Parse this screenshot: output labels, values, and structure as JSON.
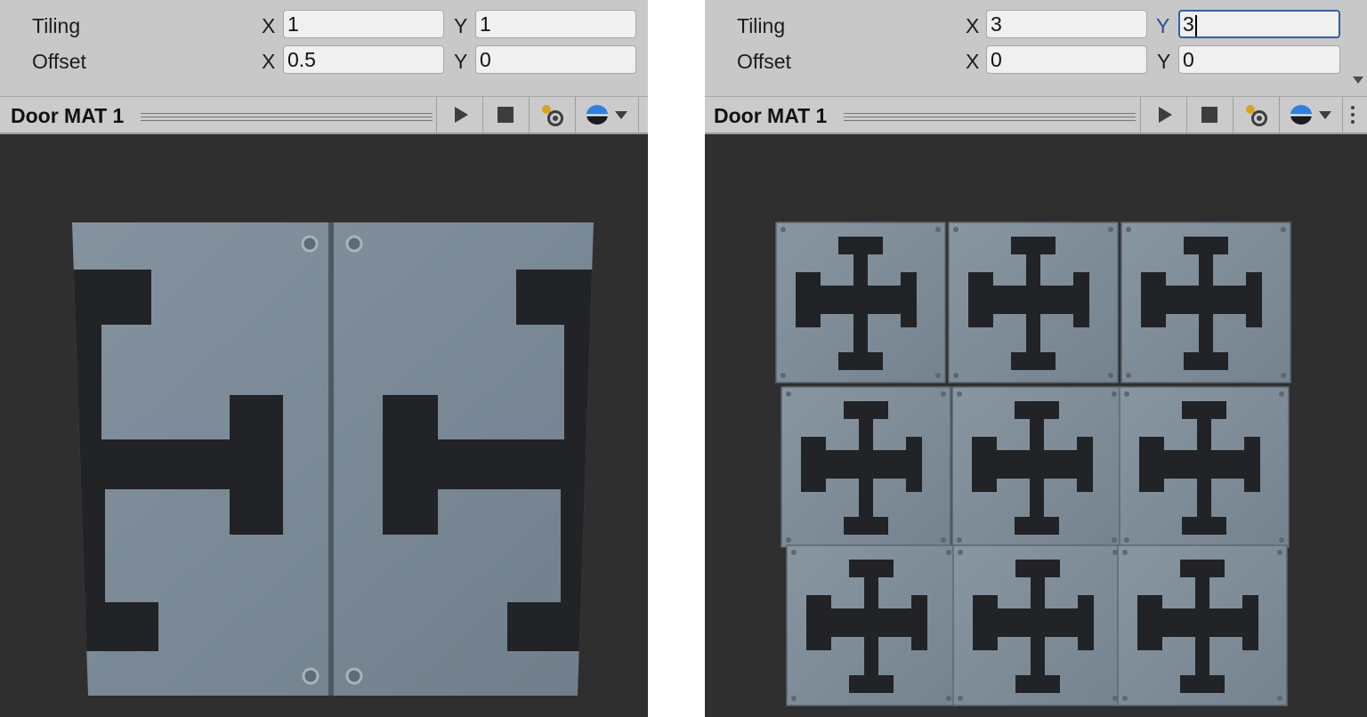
{
  "left": {
    "inspector": {
      "tiling_label": "Tiling",
      "offset_label": "Offset",
      "x_label": "X",
      "y_label": "Y",
      "tiling_x": "1",
      "tiling_y": "1",
      "offset_x": "0.5",
      "offset_y": "0"
    },
    "preview": {
      "title": "Door MAT 1"
    }
  },
  "right": {
    "inspector": {
      "tiling_label": "Tiling",
      "offset_label": "Offset",
      "x_label": "X",
      "y_label": "Y",
      "tiling_x": "3",
      "tiling_y": "3",
      "offset_x": "0",
      "offset_y": "0"
    },
    "preview": {
      "title": "Door MAT 1"
    }
  },
  "icons": {
    "play": "play-icon",
    "stop": "stop-icon",
    "light": "preview-light-icon",
    "sphere": "preview-sphere-icon",
    "dropdown": "chevron-down-icon",
    "more": "kebab-menu-icon"
  },
  "colors": {
    "viewport_bg": "#2f2f2f",
    "inspector_bg": "#c8c8c8",
    "metal": "#7f8e99",
    "dark_pattern": "#222326",
    "focus_blue": "#2f5fb0"
  }
}
